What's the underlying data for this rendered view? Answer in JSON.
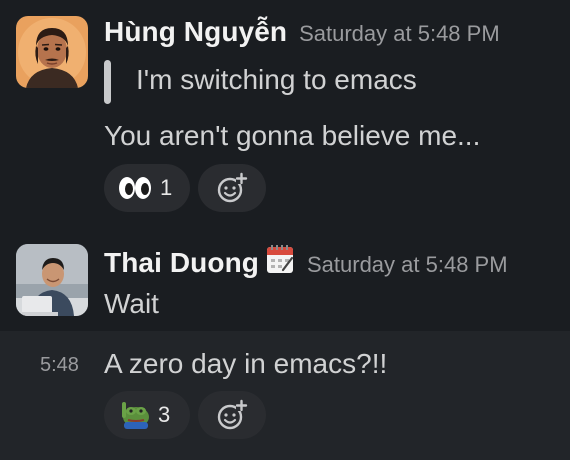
{
  "messages": [
    {
      "sender": "Hùng Nguyễn",
      "timestamp": "Saturday at 5:48 PM",
      "avatar_icon": "avatar-illustrated-man",
      "quote": "I'm switching to emacs",
      "text": "You aren't gonna believe me...",
      "reaction": {
        "emoji_icon": "eyes-emoji",
        "count": "1"
      }
    },
    {
      "sender": "Thai Duong",
      "status_emoji_icon": "calendar-emoji",
      "timestamp": "Saturday at 5:48 PM",
      "avatar_icon": "avatar-photo-man-laptop",
      "text": "Wait"
    },
    {
      "hover_time": "5:48",
      "text": "A zero day in emacs?!!",
      "reaction": {
        "emoji_icon": "pepe-frog-emoji",
        "count": "3"
      }
    }
  ],
  "colors": {
    "background": "#1a1d21",
    "hover_background": "#222529",
    "reaction_pill": "#2a2c30",
    "sender_text": "#f2f2f2",
    "body_text": "#d1d2d3",
    "muted_text": "#9a9b9e"
  },
  "icons": {
    "add_reaction": "add-reaction-icon"
  }
}
